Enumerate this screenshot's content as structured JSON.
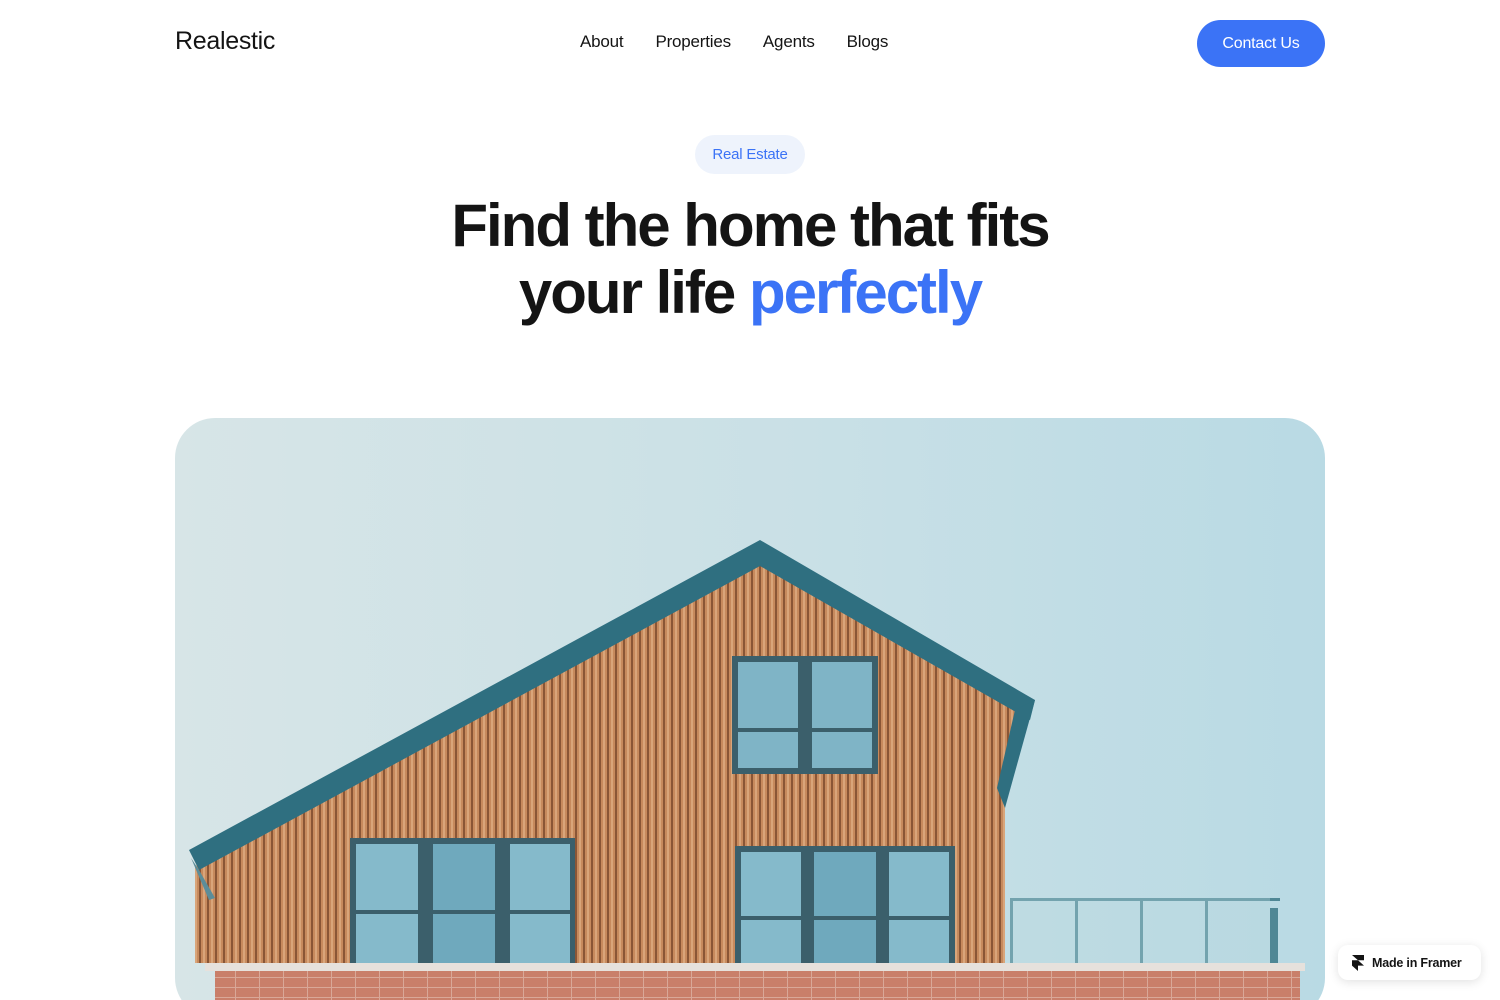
{
  "header": {
    "logo": "Realestic",
    "nav": [
      {
        "label": "About"
      },
      {
        "label": "Properties"
      },
      {
        "label": "Agents"
      },
      {
        "label": "Blogs"
      }
    ],
    "cta_label": "Contact Us"
  },
  "hero": {
    "badge": "Real Estate",
    "headline_line1": "Find the home that fits",
    "headline_line2_prefix": "your life ",
    "headline_accent": "perfectly",
    "image_alt": "house-photo"
  },
  "colors": {
    "accent": "#3b73f6",
    "badge_bg": "#eef3fc",
    "text": "#141414"
  },
  "framer_badge": {
    "label": "Made in Framer",
    "icon": "framer-logo-icon"
  }
}
